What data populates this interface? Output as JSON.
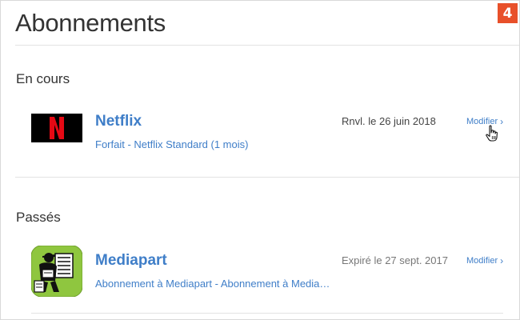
{
  "page": {
    "title": "Abonnements",
    "step_badge": "4"
  },
  "sections": [
    {
      "title": "En cours",
      "items": [
        {
          "name": "Netflix",
          "plan": "Forfait - Netflix Standard (1 mois)",
          "date": "Rnvl. le 26 juin 2018",
          "action": "Modifier"
        }
      ]
    },
    {
      "title": "Passés",
      "items": [
        {
          "name": "Mediapart",
          "plan": "Abonnement à Mediapart - Abonnement à Media…",
          "date": "Expiré le 27 sept. 2017",
          "action": "Modifier"
        }
      ]
    }
  ],
  "colors": {
    "link": "#3f7ec8",
    "badge": "#e8502a",
    "netflix_red": "#e50914",
    "mediapart_green": "#8fc63f"
  },
  "icons": {
    "netflix": "netflix-logo-icon",
    "mediapart": "mediapart-app-icon",
    "chevron": "chevron-right-icon",
    "cursor": "hand-pointer-cursor-icon"
  }
}
